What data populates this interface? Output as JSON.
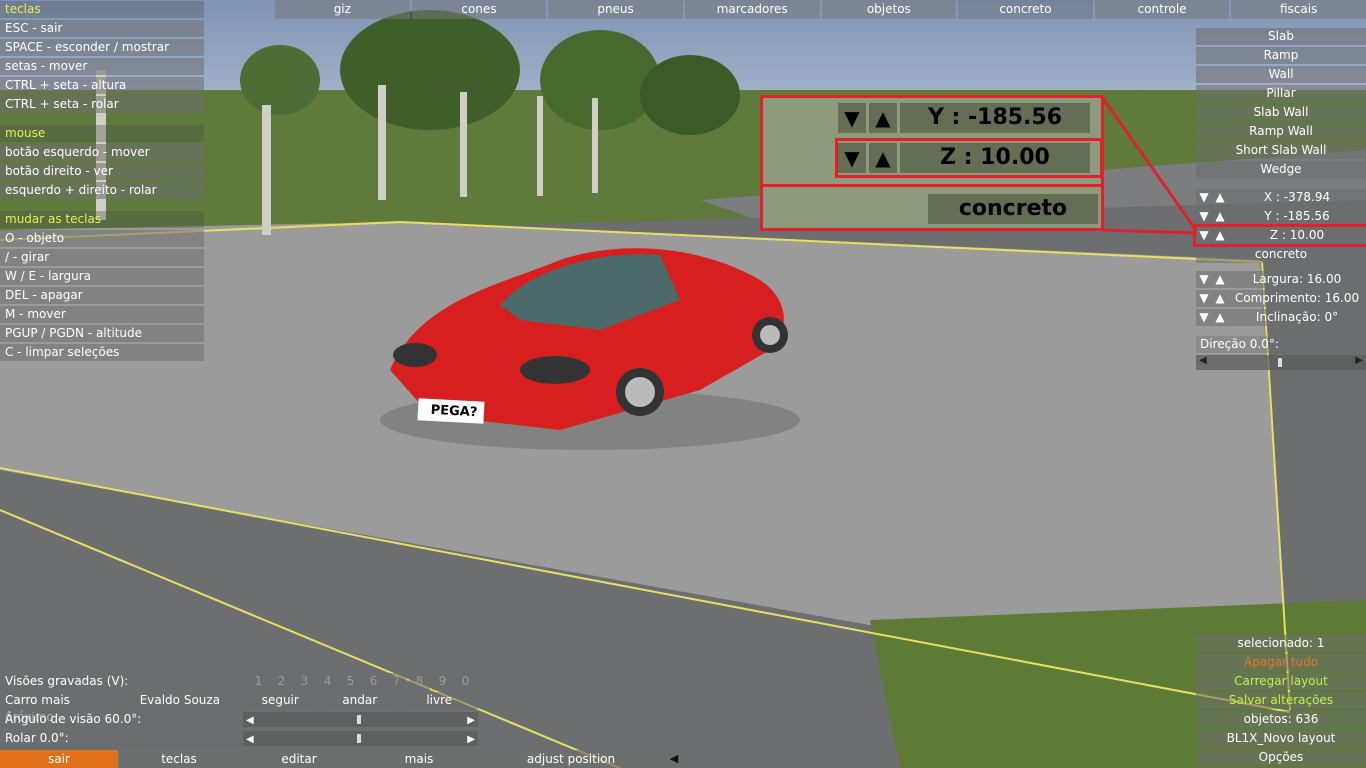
{
  "scene": {
    "car_plate": "PEGA?"
  },
  "left_panel": {
    "keys_header": "teclas",
    "keys": [
      "ESC - sair",
      "SPACE - esconder / mostrar",
      "setas - mover",
      "CTRL + seta - altura",
      "CTRL + seta - rolar"
    ],
    "mouse_header": "mouse",
    "mouse": [
      "botão esquerdo - mover",
      "botão direito - ver",
      "esquerdo + direito - rolar"
    ],
    "change_header": "mudar as teclas",
    "change": [
      "O - objeto",
      "/  - girar",
      "W / E - largura",
      "DEL - apagar",
      "M - mover",
      "PGUP / PGDN - altitude",
      "C - limpar seleções"
    ]
  },
  "top_tabs": [
    "giz",
    "cones",
    "pneus",
    "marcadores",
    "objetos",
    "concreto",
    "controle",
    "fiscais"
  ],
  "right_panel": {
    "objects": [
      "Slab",
      "Ramp",
      "Wall",
      "Pillar",
      "Slab Wall",
      "Ramp Wall",
      "Short Slab Wall",
      "Wedge"
    ],
    "x": "X : -378.94",
    "y": "Y : -185.56",
    "z": "Z : 10.00",
    "material": "concreto",
    "largura": "Largura: 16.00",
    "comprimento": "Comprimento: 16.00",
    "inclinacao": "Inclinação: 0°",
    "direcao": "Direção 0.0°:",
    "selected": "selecionado: 1",
    "apagar_tudo": "Apagar tudo",
    "carregar": "Carregar layout",
    "salvar": "Salvar alterações",
    "objetos": "objetos: 636",
    "layout": "BL1X_Novo layout",
    "opcoes": "Opções"
  },
  "zoom_callout": {
    "y": "Y : -185.56",
    "z": "Z : 10.00",
    "material": "concreto"
  },
  "bottom_left": {
    "visoes": "Visões gravadas (V):",
    "view_numbers": [
      "1",
      "2",
      "3",
      "4",
      "5",
      "6",
      "7",
      "8",
      "9",
      "0"
    ],
    "carro_label": "Carro mais próximo:",
    "carro_name": "Evaldo Souza",
    "seguir": "seguir",
    "andar": "andar",
    "livre": "livre",
    "angulo": "Ângulo de visão 60.0°:",
    "rolar": "Rolar 0.0°:"
  },
  "bottom_bar": [
    "sair",
    "teclas",
    "editar",
    "mais",
    "adjust position"
  ],
  "colors": {
    "header_yellow": "#e8f050",
    "callout_red": "#e0202a",
    "car_red": "#d81f1f",
    "exit_orange": "#e0701a",
    "green_text": "#c8f040",
    "orange_text": "#e07820"
  }
}
